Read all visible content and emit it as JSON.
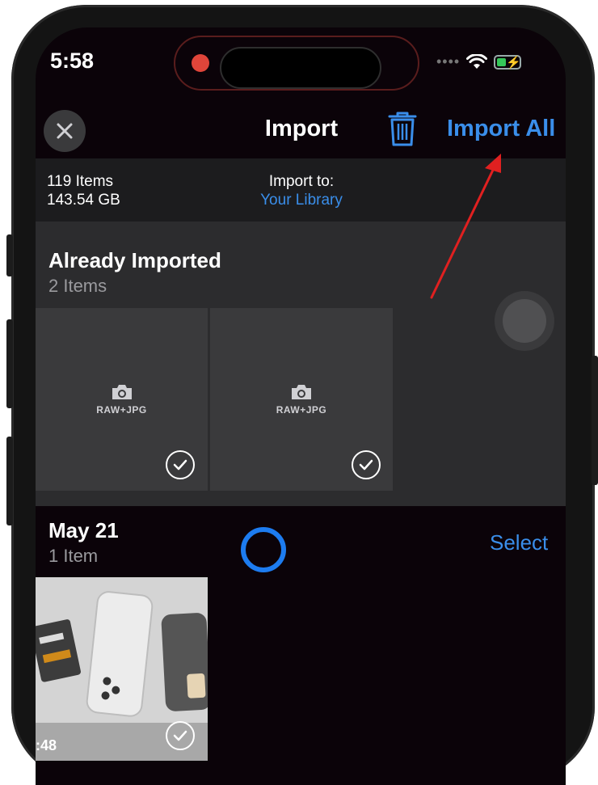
{
  "status_bar": {
    "time": "5:58",
    "signal_dots": "••••"
  },
  "nav": {
    "title": "Import",
    "import_all": "Import All"
  },
  "info": {
    "items_count": "119 Items",
    "size": "143.54 GB",
    "import_to_label": "Import to:",
    "destination": "Your Library"
  },
  "already_imported": {
    "title": "Already Imported",
    "count": "2 Items",
    "tiles": [
      {
        "format": "RAW+JPG"
      },
      {
        "format": "RAW+JPG"
      }
    ]
  },
  "may21": {
    "title": "May 21",
    "count": "1 Item",
    "select_label": "Select",
    "video_duration": ":48"
  },
  "colors": {
    "accent": "#3a8eea",
    "annotation_arrow": "#e02020",
    "recording": "#e0453a"
  },
  "icons": [
    "close-icon",
    "trash-icon",
    "camera-icon",
    "checkmark-icon",
    "wifi-icon",
    "battery-icon"
  ]
}
